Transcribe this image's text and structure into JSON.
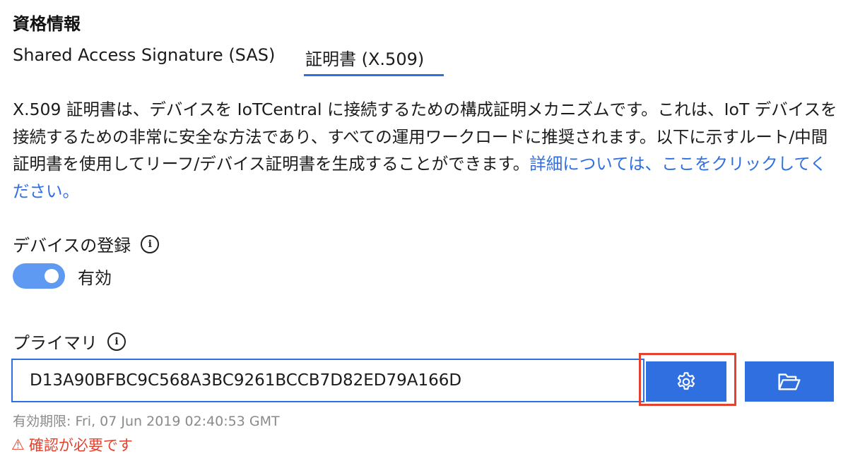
{
  "section": {
    "title": "資格情報"
  },
  "tabs": [
    {
      "label": "Shared Access Signature (SAS)",
      "active": false
    },
    {
      "label": "証明書 (X.509)",
      "active": true
    }
  ],
  "description": {
    "text": "X.509 証明書は、デバイスを IoTCentral に接続するための構成証明メカニズムです。これは、IoT デバイスを接続するための非常に安全な方法であり、すべての運用ワークロードに推奨されます。以下に示すルート/中間証明書を使用してリーフ/デバイス証明書を生成することができます。",
    "link": "詳細については、ここをクリックしてください。"
  },
  "device_enrollment": {
    "label": "デバイスの登録",
    "info_glyph": "i",
    "toggle_on": true,
    "toggle_label": "有効"
  },
  "primary": {
    "label": "プライマリ",
    "info_glyph": "i",
    "thumbprint": "D13A90BFBC9C568A3BC9261BCCB7D82ED79A166D",
    "expiry": "有効期限: Fri, 07 Jun 2019 02:40:53 GMT",
    "warning_icon": "⚠",
    "warning": "確認が必要です",
    "gear_icon": "gear-icon",
    "folder_icon": "folder-open-icon"
  },
  "colors": {
    "accent": "#2f6fe0",
    "toggle": "#5e99f2",
    "warning": "#e5412f",
    "highlight": "#e5412f"
  }
}
